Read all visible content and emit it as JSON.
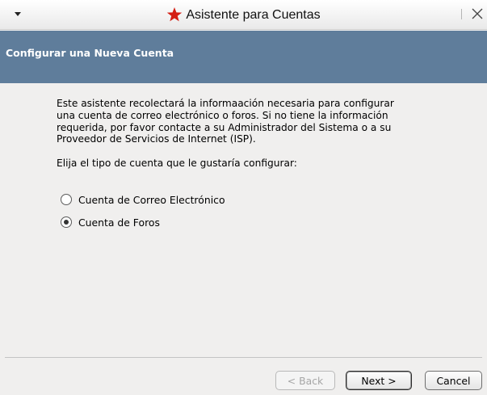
{
  "window": {
    "title": "Asistente para Cuentas",
    "menu_icon": "window-menu-chevron-icon",
    "title_icon": "red-star-icon",
    "close_icon": "close-x-icon"
  },
  "header": {
    "title": "Configurar una Nueva Cuenta",
    "background_color": "#5f7d9b"
  },
  "body": {
    "description_lines": [
      "Este asistente recolectará la informaación necesaria para configurar",
      "una cuenta de correo electrónico o foros. Si no tiene la información",
      "requerida, por favor contacte a su Administrador del Sistema o a su",
      "Proveedor de Servicios de Internet (ISP)."
    ],
    "prompt": "Elija el tipo de cuenta que le gustaría configurar:",
    "options": [
      {
        "label": "Cuenta de Correo Electrónico",
        "selected": false
      },
      {
        "label": "Cuenta de Foros",
        "selected": true
      }
    ]
  },
  "buttons": {
    "back": "< Back",
    "next": "Next >",
    "cancel": "Cancel"
  }
}
